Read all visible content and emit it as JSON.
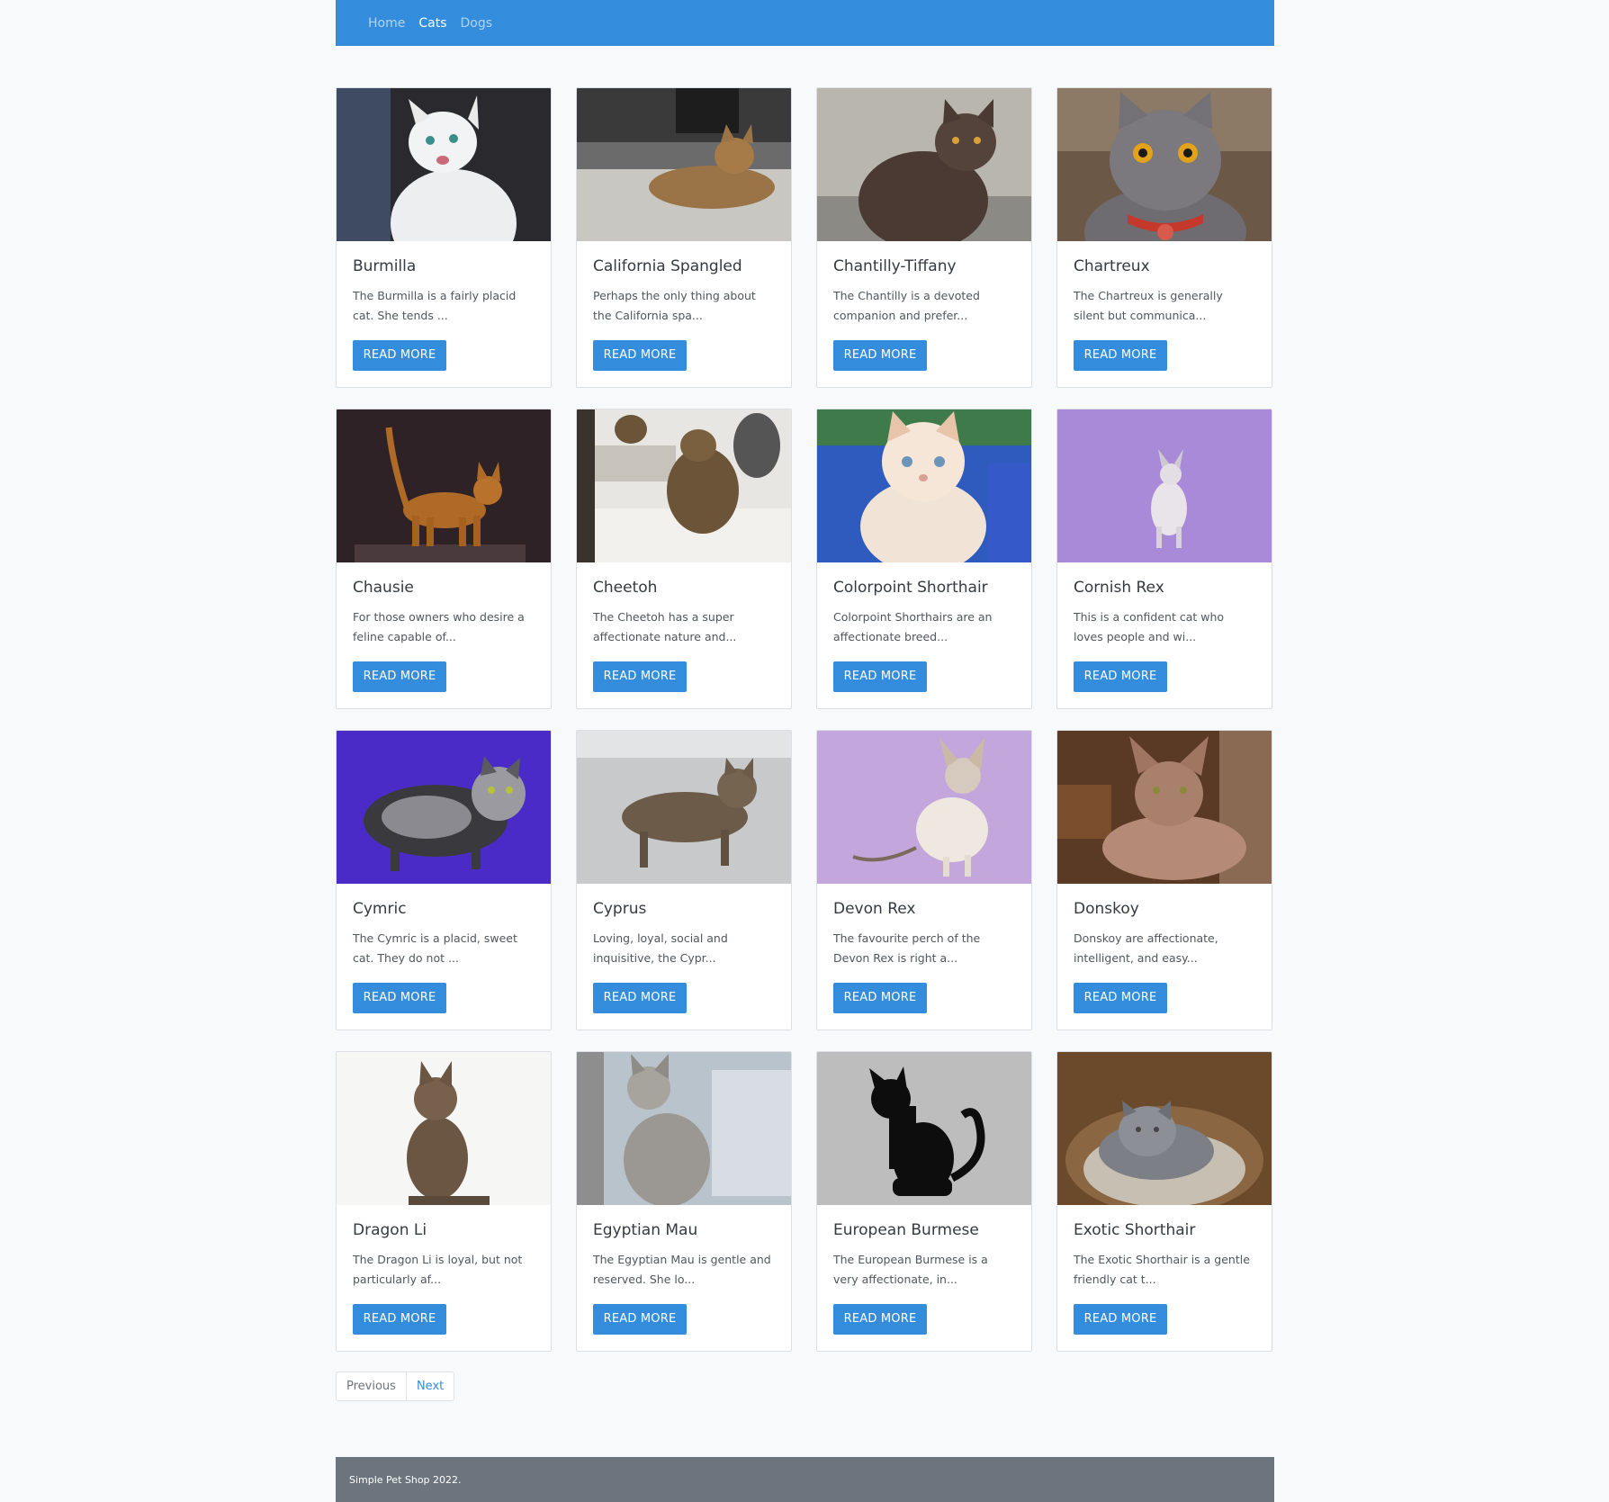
{
  "nav": {
    "items": [
      {
        "label": "Home",
        "active": false
      },
      {
        "label": "Cats",
        "active": true
      },
      {
        "label": "Dogs",
        "active": false
      }
    ]
  },
  "cards": [
    {
      "title": "Burmilla",
      "text": "The Burmilla is a fairly placid cat. She tends ...",
      "button": "READ MORE"
    },
    {
      "title": "California Spangled",
      "text": "Perhaps the only thing about the California spa...",
      "button": "READ MORE"
    },
    {
      "title": "Chantilly-Tiffany",
      "text": "The Chantilly is a devoted companion and prefer...",
      "button": "READ MORE"
    },
    {
      "title": "Chartreux",
      "text": "The Chartreux is generally silent but communica...",
      "button": "READ MORE"
    },
    {
      "title": "Chausie",
      "text": "For those owners who desire a feline capable of...",
      "button": "READ MORE"
    },
    {
      "title": "Cheetoh",
      "text": "The Cheetoh has a super affectionate nature and...",
      "button": "READ MORE"
    },
    {
      "title": "Colorpoint Shorthair",
      "text": "Colorpoint Shorthairs are an affectionate breed...",
      "button": "READ MORE"
    },
    {
      "title": "Cornish Rex",
      "text": "This is a confident cat who loves people and wi...",
      "button": "READ MORE"
    },
    {
      "title": "Cymric",
      "text": "The Cymric is a placid, sweet cat. They do not ...",
      "button": "READ MORE"
    },
    {
      "title": "Cyprus",
      "text": "Loving, loyal, social and inquisitive, the Cypr...",
      "button": "READ MORE"
    },
    {
      "title": "Devon Rex",
      "text": "The favourite perch of the Devon Rex is right a...",
      "button": "READ MORE"
    },
    {
      "title": "Donskoy",
      "text": "Donskoy are affectionate, intelligent, and easy...",
      "button": "READ MORE"
    },
    {
      "title": "Dragon Li",
      "text": "The Dragon Li is loyal, but not particularly af...",
      "button": "READ MORE"
    },
    {
      "title": "Egyptian Mau",
      "text": "The Egyptian Mau is gentle and reserved. She lo...",
      "button": "READ MORE"
    },
    {
      "title": "European Burmese",
      "text": "The European Burmese is a very affectionate, in...",
      "button": "READ MORE"
    },
    {
      "title": "Exotic Shorthair",
      "text": "The Exotic Shorthair is a gentle friendly cat t...",
      "button": "READ MORE"
    }
  ],
  "pagination": {
    "previous": "Previous",
    "next": "Next"
  },
  "footer": {
    "text": "Simple Pet Shop 2022."
  },
  "colors": {
    "primary": "#338ddc",
    "footer": "#6c757d",
    "background": "#f8f9fa"
  }
}
